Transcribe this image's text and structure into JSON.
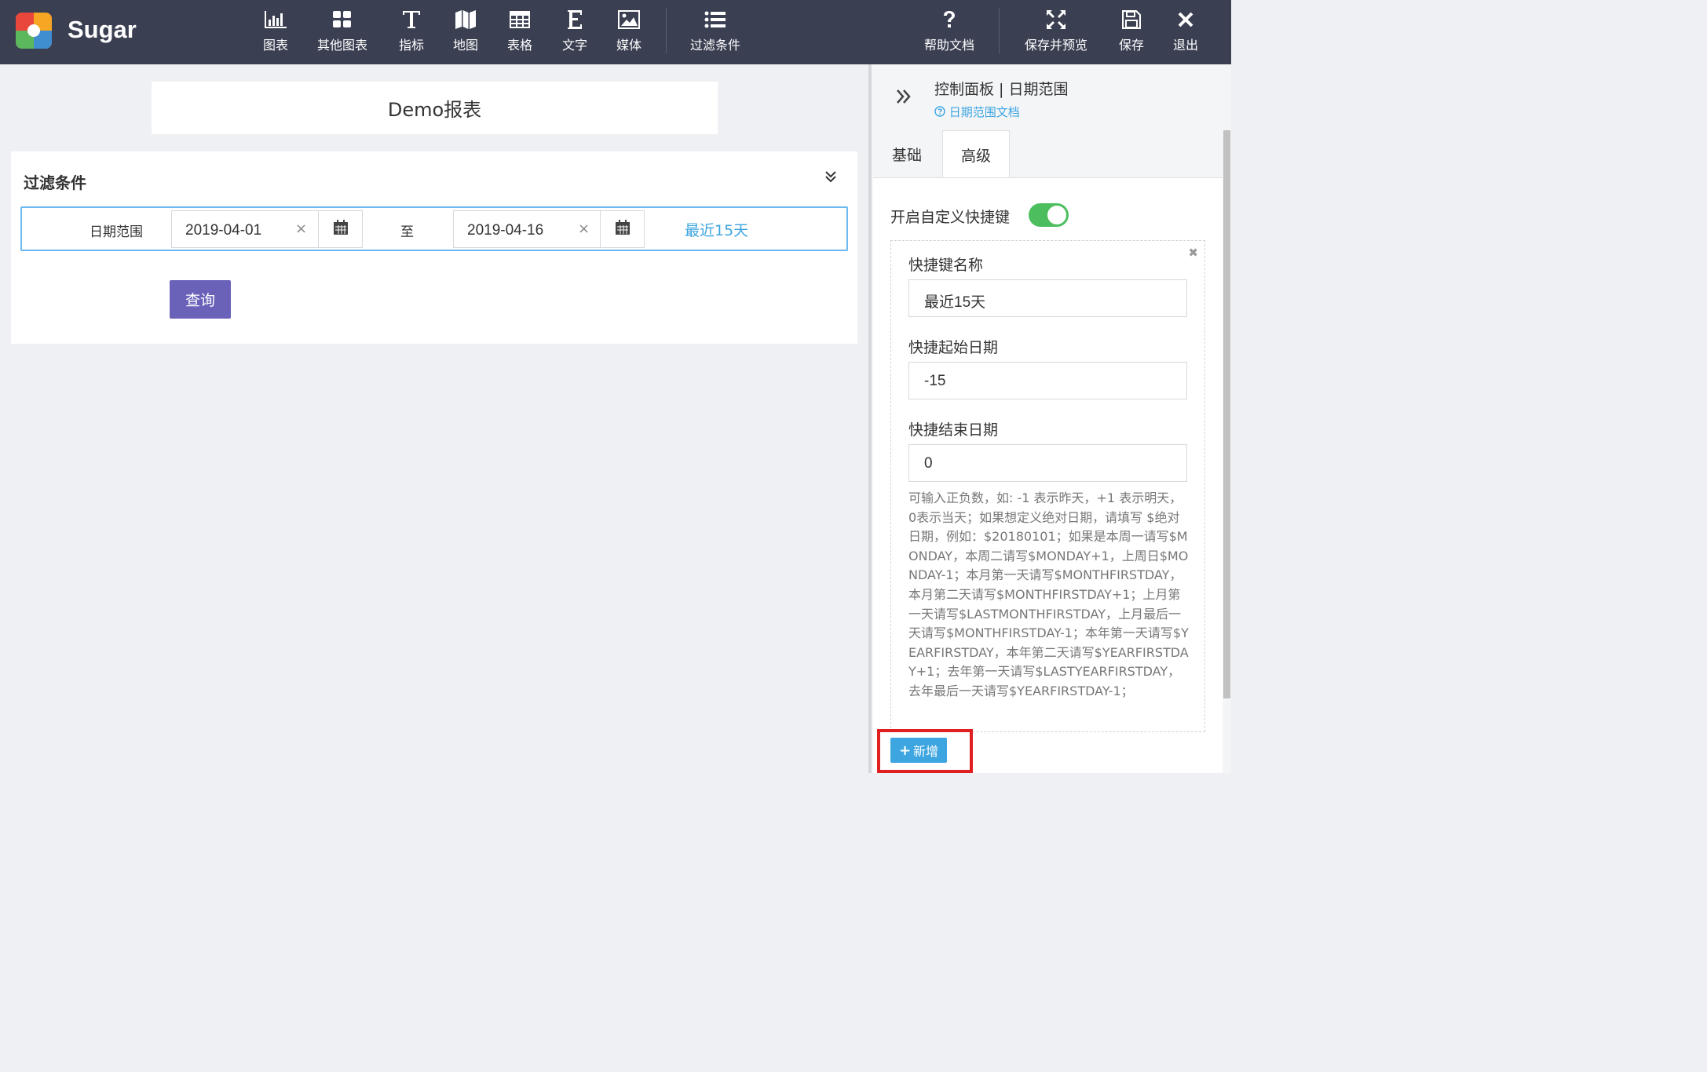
{
  "app": {
    "brand": "Sugar"
  },
  "toolbar": {
    "items": [
      {
        "label": "图表",
        "icon": "bar-chart-icon"
      },
      {
        "label": "其他图表",
        "icon": "grid-icon"
      },
      {
        "label": "指标",
        "icon": "text-t-icon"
      },
      {
        "label": "地图",
        "icon": "map-icon"
      },
      {
        "label": "表格",
        "icon": "table-icon"
      },
      {
        "label": "文字",
        "icon": "text-e-icon"
      },
      {
        "label": "媒体",
        "icon": "image-icon"
      },
      {
        "label": "过滤条件",
        "icon": "list-icon"
      }
    ],
    "right_items": [
      {
        "label": "帮助文档",
        "icon": "question-icon"
      },
      {
        "label": "保存并预览",
        "icon": "expand-icon"
      },
      {
        "label": "保存",
        "icon": "save-icon"
      },
      {
        "label": "退出",
        "icon": "close-icon"
      }
    ]
  },
  "report": {
    "title": "Demo报表"
  },
  "filter": {
    "title": "过滤条件",
    "row_label": "日期范围",
    "start_date": "2019-04-01",
    "end_date": "2019-04-16",
    "to_label": "至",
    "clear_symbol": "×",
    "quick_link": "最近15天",
    "query_button": "查询"
  },
  "panel": {
    "title": "控制面板 | 日期范围",
    "doc_link": "日期范围文档",
    "tabs": [
      {
        "label": "基础",
        "active": false
      },
      {
        "label": "高级",
        "active": true
      }
    ],
    "custom_shortcut_label": "开启自定义快捷键",
    "custom_shortcut_enabled": true,
    "remove_symbol": "✖",
    "shortcut": {
      "name_label": "快捷键名称",
      "name_value": "最近15天",
      "start_label": "快捷起始日期",
      "start_value": "-15",
      "end_label": "快捷结束日期",
      "end_value": "0",
      "help": "可输入正负数，如: -1 表示昨天，+1 表示明天，0表示当天；如果想定义绝对日期，请填写 $绝对日期，例如：$20180101；如果是本周一请写$MONDAY，本周二请写$MONDAY+1，上周日$MONDAY-1；本月第一天请写$MONTHFIRSTDAY，本月第二天请写$MONTHFIRSTDAY+1；上月第一天请写$LASTMONTHFIRSTDAY，上月最后一天请写$MONTHFIRSTDAY-1；本年第一天请写$YEARFIRSTDAY，本年第二天请写$YEARFIRSTDAY+1；去年第一天请写$LASTYEARFIRSTDAY，去年最后一天请写$YEARFIRSTDAY-1；"
    },
    "add_button": "新增"
  },
  "colors": {
    "topbar": "#3a3f51",
    "accent_blue": "#3da5e0",
    "query_purple": "#6a62b8",
    "toggle_green": "#4cbe5e",
    "highlight_red": "#e02020"
  }
}
